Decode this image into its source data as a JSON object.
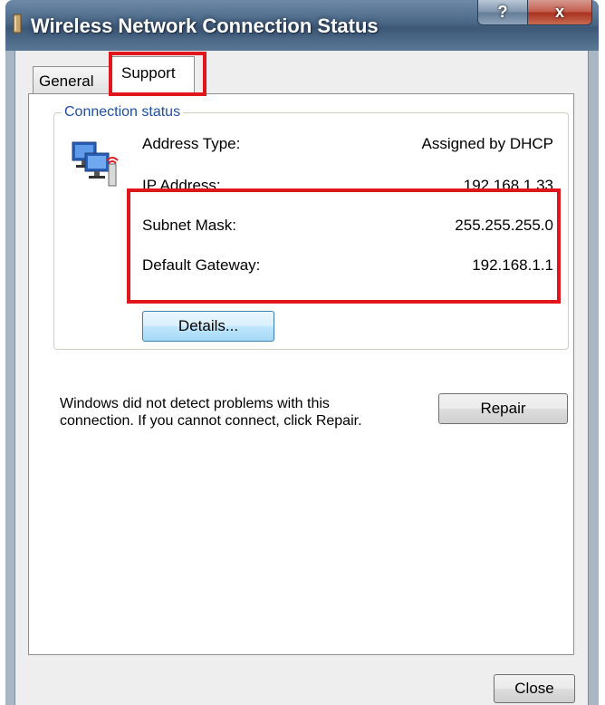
{
  "window": {
    "title": "Wireless Network Connection Status"
  },
  "caption_buttons": {
    "help": "?",
    "close": "x"
  },
  "tabs": [
    {
      "label": "General",
      "selected": false
    },
    {
      "label": "Support",
      "selected": true
    }
  ],
  "connection_status": {
    "group_title": "Connection status",
    "rows": [
      {
        "label": "Address Type:",
        "value": "Assigned by DHCP"
      },
      {
        "label": "IP Address:",
        "value": "192.168.1.33"
      },
      {
        "label": "Subnet Mask:",
        "value": "255.255.255.0"
      },
      {
        "label": "Default Gateway:",
        "value": "192.168.1.1"
      }
    ],
    "details_button": "Details..."
  },
  "status_message": "Windows did not detect problems with this connection. If you cannot connect, click Repair.",
  "repair_button": "Repair",
  "close_button": "Close",
  "colors": {
    "highlight": "#e0161d",
    "group_title": "#1f4fa3"
  }
}
